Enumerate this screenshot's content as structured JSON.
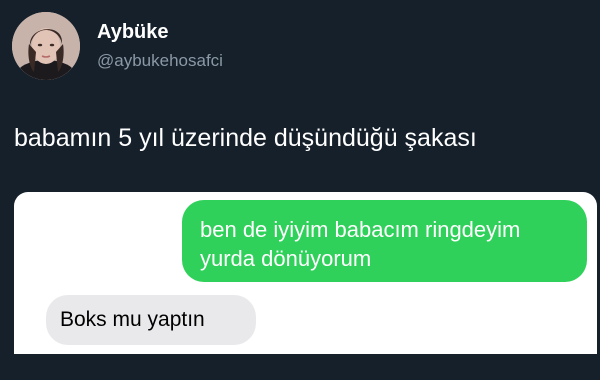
{
  "author": {
    "name": "Aybüke",
    "handle": "@aybukehosafci"
  },
  "tweet": {
    "text": "babamın 5 yıl üzerinde düşündüğü şakası"
  },
  "media": {
    "messages": [
      {
        "direction": "sent",
        "lines": [
          "ben de iyiyim babacım ringdeyim",
          "yurda dönüyorum"
        ]
      },
      {
        "direction": "received",
        "text": "Boks mu yaptın"
      }
    ]
  },
  "colors": {
    "background": "#15202b",
    "sent_bubble": "#2fd15a",
    "received_bubble": "#e9e9eb",
    "handle": "#8b98a5"
  }
}
